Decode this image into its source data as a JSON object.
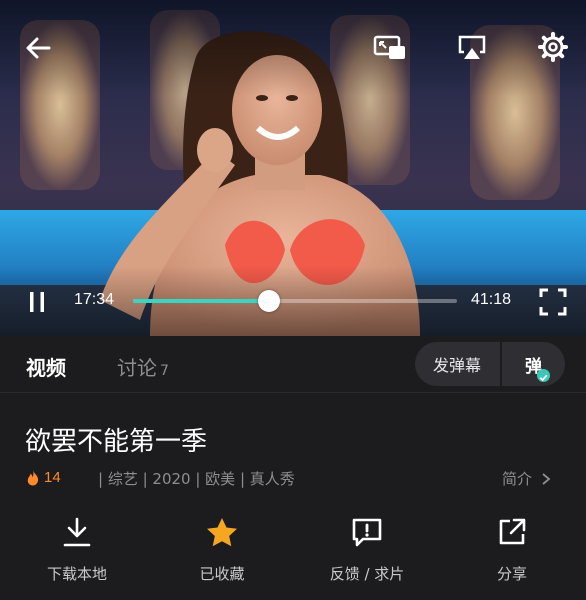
{
  "player": {
    "current_time": "17:34",
    "total_time": "41:18",
    "progress": 0.42
  },
  "tabs": {
    "video_label": "视频",
    "discuss_label": "讨论",
    "discuss_count": "7"
  },
  "danmu": {
    "send_label": "发弹幕",
    "toggle_char": "弹"
  },
  "show": {
    "title": "欲罢不能第一季",
    "heat": "14",
    "meta": "| 综艺 | 2020 | 欧美 | 真人秀",
    "intro_label": "简介"
  },
  "actions": [
    {
      "label": "下载本地",
      "icon": "download-icon"
    },
    {
      "label": "已收藏",
      "icon": "star-icon"
    },
    {
      "label": "反馈 / 求片",
      "icon": "feedback-icon"
    },
    {
      "label": "分享",
      "icon": "share-icon"
    }
  ],
  "colors": {
    "accent": "#39d5c1",
    "background": "#1c1c1e",
    "favorite": "#f5a623",
    "heat": "#ff8a2a"
  }
}
